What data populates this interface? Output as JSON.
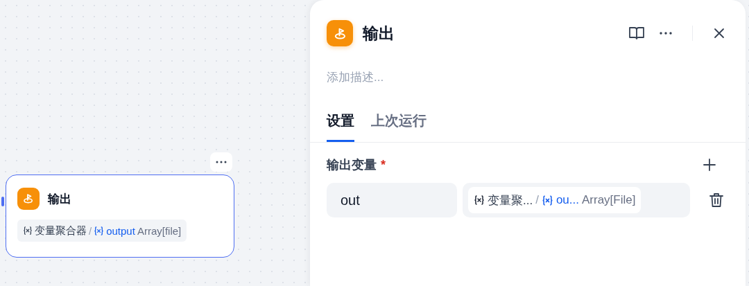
{
  "canvas": {
    "node": {
      "title": "输出",
      "variable": {
        "node_name": "变量聚合器",
        "separator": "/",
        "var_name": "output",
        "type": "Array[file]"
      }
    }
  },
  "panel": {
    "title": "输出",
    "description_placeholder": "添加描述...",
    "tabs": [
      {
        "label": "设置",
        "selected": true
      },
      {
        "label": "上次运行",
        "selected": false
      }
    ],
    "section": {
      "label": "输出变量",
      "required_mark": "*",
      "variables": [
        {
          "name": "out",
          "node_name": "变量聚...",
          "separator": "/",
          "var_name": "ou...",
          "type": "Array[File]"
        }
      ]
    }
  }
}
